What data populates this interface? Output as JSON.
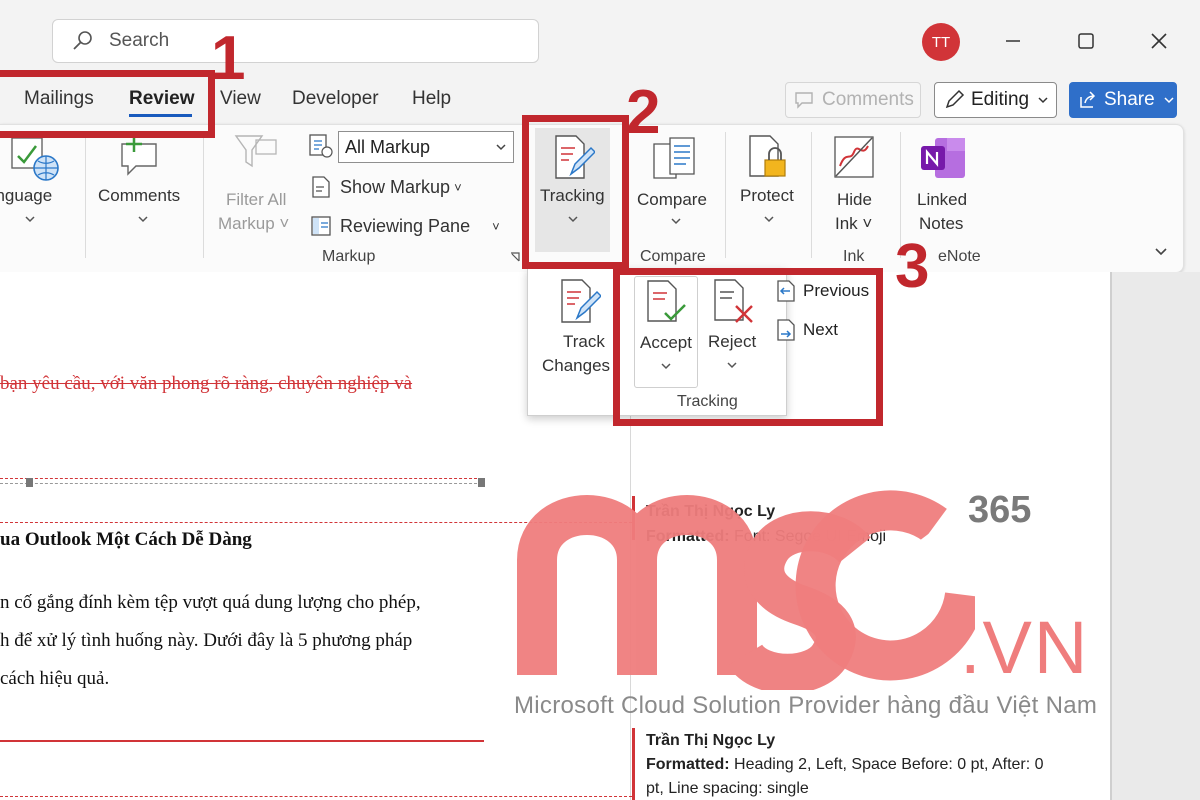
{
  "titlebar": {
    "search_placeholder": "Search",
    "avatar_initials": "TT"
  },
  "tabs": [
    "Mailings",
    "Review",
    "View",
    "Developer",
    "Help"
  ],
  "top_buttons": {
    "comments": "Comments",
    "editing": "Editing",
    "share": "Share"
  },
  "ribbon": {
    "language": "anguage",
    "comments": "Comments",
    "filter_all_markup_1": "Filter All",
    "filter_all_markup_2": "Markup",
    "markup_select": "All Markup",
    "show_markup": "Show Markup",
    "reviewing_pane": "Reviewing Pane",
    "markup_group": "Markup",
    "tracking": "Tracking",
    "compare": "Compare",
    "compare_group": "Compare",
    "protect": "Protect",
    "hide_ink_1": "Hide",
    "hide_ink_2": "Ink",
    "ink_group": "Ink",
    "linked_notes_1": "Linked",
    "linked_notes_2": "Notes",
    "onenote_group": "eNote"
  },
  "dropdown": {
    "track_changes_1": "Track",
    "track_changes_2": "Changes",
    "accept": "Accept",
    "reject": "Reject",
    "previous": "Previous",
    "next": "Next",
    "group_label": "Tracking"
  },
  "callouts": [
    "1",
    "2",
    "3"
  ],
  "document": {
    "deleted_line": "bạn yêu cầu, với văn phong rõ ràng, chuyên nghiệp và",
    "heading": "ua Outlook Một Cách Dễ Dàng",
    "para1": "n cố gắng đính kèm tệp vượt quá dung lượng cho phép,",
    "para2": "h để xử lý tình huống này. Dưới đây là 5 phương pháp",
    "para3": "cách hiệu quả."
  },
  "comments": [
    {
      "author": "Trần Thị Ngọc Ly",
      "label": "Formatted:",
      "detail": "Font: Segoe UI Emoji"
    },
    {
      "author": "Trần Thị Ngọc Ly",
      "label": "Formatted:",
      "detail": "Heading 2, Left, Space Before:  0 pt, After:  0",
      "detail2": "pt, Line spacing:  single"
    }
  ],
  "watermark": {
    "brand": "MSO",
    "suffix": "365",
    "domain": ".VN",
    "tagline": "Microsoft Cloud Solution Provider hàng đầu Việt Nam"
  },
  "colors": {
    "accent_red": "#c1272d",
    "share_blue": "#2f6fc9",
    "watermark_pink": "#ef7d7d",
    "deleted_text": "#d13438"
  }
}
